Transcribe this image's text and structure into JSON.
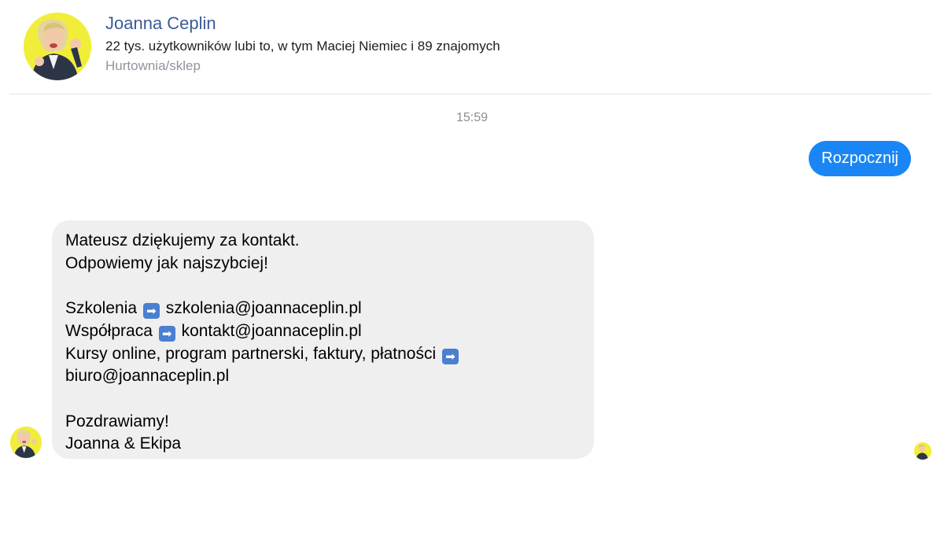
{
  "header": {
    "title": "Joanna Ceplin",
    "likes_text": "22 tys. użytkowników lubi to, w tym Maciej Niemiec i 89 znajomych",
    "category": "Hurtownia/sklep"
  },
  "conversation": {
    "timestamp": "15:59",
    "outgoing_message": "Rozpocznij",
    "incoming_message": {
      "lines": [
        {
          "text": "Mateusz dziękujemy za kontakt."
        },
        {
          "text": "Odpowiemy jak najszybciej!"
        },
        {
          "text": ""
        },
        {
          "label": "Szkolenia",
          "arrow": "➡",
          "value": "szkolenia@joannaceplin.pl"
        },
        {
          "label": "Współpraca",
          "arrow": "➡",
          "value": "kontakt@joannaceplin.pl"
        },
        {
          "label": "Kursy online, program partnerski, faktury, płatności",
          "arrow": "➡"
        },
        {
          "text": "biuro@joannaceplin.pl"
        },
        {
          "text": ""
        },
        {
          "text": "Pozdrawiamy!"
        },
        {
          "text": "Joanna & Ekipa"
        }
      ]
    }
  },
  "icons": {
    "profile_avatar": "profile-photo-icon",
    "arrow": "right-arrow-emoji-icon",
    "read_receipt": "read-receipt-avatar-icon"
  },
  "colors": {
    "title": "#3b5b98",
    "outgoing_bubble": "#1a86f5",
    "incoming_bubble": "#efefef",
    "avatar_background": "#f3f23a"
  }
}
